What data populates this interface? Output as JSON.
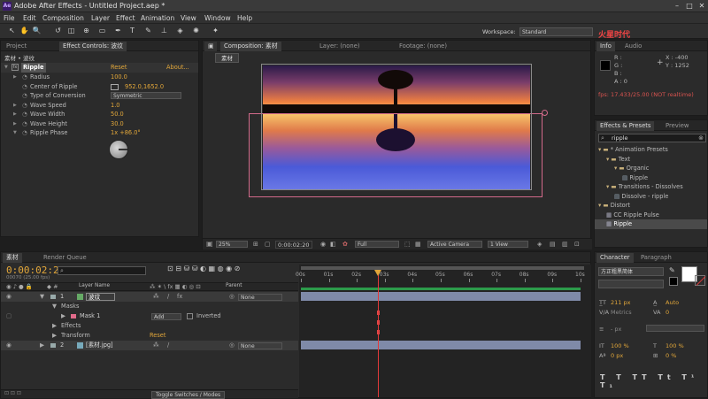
{
  "app": {
    "title": "Adobe After Effects - Untitled Project.aep *",
    "logo_text": "Ae",
    "watermark": "火星时代 hxsd.tv"
  },
  "menu": [
    "File",
    "Edit",
    "Composition",
    "Layer",
    "Effect",
    "Animation",
    "View",
    "Window",
    "Help"
  ],
  "workspace": {
    "label": "Workspace:",
    "value": "Standard"
  },
  "project_panel": {
    "tab_project": "Project",
    "tab_effect": "Effect Controls: 波纹",
    "header": "素材 • 波纹"
  },
  "effect": {
    "name": "Ripple",
    "reset": "Reset",
    "about": "About...",
    "props": [
      {
        "label": "Radius",
        "value": "100.0"
      },
      {
        "label": "Center of Ripple",
        "value": "952.0,1652.0"
      },
      {
        "label": "Type of Conversion",
        "value": "Symmetric"
      },
      {
        "label": "Wave Speed",
        "value": "1.0"
      },
      {
        "label": "Wave Width",
        "value": "50.0"
      },
      {
        "label": "Wave Height",
        "value": "30.0"
      },
      {
        "label": "Ripple Phase",
        "value": "1x +86.0°"
      }
    ]
  },
  "comp_panel": {
    "tab_comp": "Composition: 素材",
    "tab_layer": "Layer: (none)",
    "tab_footage": "Footage: (none)",
    "comp_button": "素材",
    "footer": {
      "zoom": "25%",
      "time": "0:00:02:20",
      "resolution": "Full",
      "camera": "Active Camera",
      "views": "1 View"
    }
  },
  "info": {
    "tab_info": "Info",
    "tab_audio": "Audio",
    "r": "R :",
    "g": "G :",
    "b": "B :",
    "a": "A : 0",
    "x": "X : -400",
    "y": "Y : 1252",
    "fps": "fps: 17.433/25.00 (NOT realtime)"
  },
  "effects_presets": {
    "tab": "Effects & Presets",
    "tab_preview": "Preview",
    "search": "ripple",
    "tree": [
      {
        "label": "* Animation Presets",
        "indent": 0,
        "type": "folder-open"
      },
      {
        "label": "Text",
        "indent": 1,
        "type": "folder-open"
      },
      {
        "label": "Organic",
        "indent": 2,
        "type": "folder-open"
      },
      {
        "label": "Ripple",
        "indent": 3,
        "type": "preset"
      },
      {
        "label": "Transitions - Dissolves",
        "indent": 1,
        "type": "folder-open"
      },
      {
        "label": "Dissolve - ripple",
        "indent": 2,
        "type": "preset"
      },
      {
        "label": "Distort",
        "indent": 0,
        "type": "folder-open"
      },
      {
        "label": "CC Ripple Pulse",
        "indent": 1,
        "type": "effect"
      },
      {
        "label": "Ripple",
        "indent": 1,
        "type": "effect",
        "selected": true
      }
    ]
  },
  "timeline": {
    "tab_comp": "素材",
    "tab_render": "Render Queue",
    "timecode": "0:00:02:20",
    "frame": "00070 (25.00 fps)",
    "col_layer_name": "Layer Name",
    "col_parent": "Parent",
    "ruler": [
      "00s",
      "01s",
      "02s",
      "03s",
      "04s",
      "05s",
      "06s",
      "07s",
      "08s",
      "09s",
      "10s"
    ],
    "layers": [
      {
        "num": "1",
        "name": "波纹",
        "parent": "None"
      },
      {
        "num": "2",
        "name": "[素材.jpg]",
        "parent": "None"
      }
    ],
    "masks_label": "Masks",
    "mask1": "Mask 1",
    "mask_mode": "Add",
    "inverted": "Inverted",
    "effects_label": "Effects",
    "transform_label": "Transform",
    "transform_reset": "Reset",
    "toggle": "Toggle Switches / Modes"
  },
  "character": {
    "tab": "Character",
    "tab_para": "Paragraph",
    "font": "方正粗黑简体",
    "size": "211 px",
    "leading": "Auto",
    "metrics": "Metrics",
    "tracking": "0",
    "stroke": "- px",
    "vscale": "100 %",
    "hscale": "100 %",
    "baseline": "0 px",
    "tsume": "0 %"
  }
}
